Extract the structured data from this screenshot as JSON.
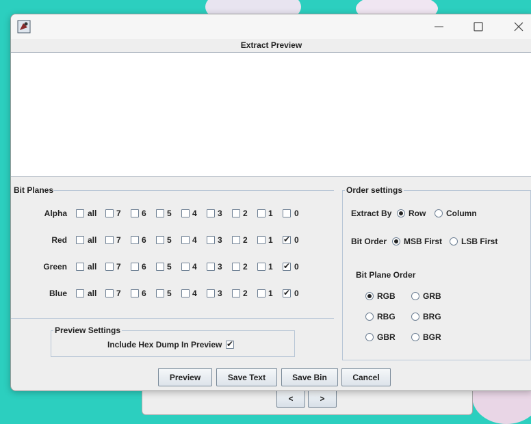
{
  "dialog": {
    "title": "Extract Preview",
    "bit_planes": {
      "title": "Bit Planes",
      "rows": [
        {
          "label": "Alpha",
          "checks": [
            false,
            false,
            false,
            false,
            false,
            false,
            false,
            false,
            false
          ]
        },
        {
          "label": "Red",
          "checks": [
            false,
            false,
            false,
            false,
            false,
            false,
            false,
            false,
            true
          ]
        },
        {
          "label": "Green",
          "checks": [
            false,
            false,
            false,
            false,
            false,
            false,
            false,
            false,
            true
          ]
        },
        {
          "label": "Blue",
          "checks": [
            false,
            false,
            false,
            false,
            false,
            false,
            false,
            false,
            true
          ]
        }
      ],
      "column_labels": [
        "all",
        "7",
        "6",
        "5",
        "4",
        "3",
        "2",
        "1",
        "0"
      ]
    },
    "preview_settings": {
      "title": "Preview Settings",
      "hex_dump_label": "Include Hex Dump In Preview",
      "hex_dump_checked": true
    },
    "order_settings": {
      "title": "Order settings",
      "extract_by_label": "Extract By",
      "extract_by_options": [
        "Row",
        "Column"
      ],
      "extract_by_selected": "Row",
      "bit_order_label": "Bit Order",
      "bit_order_options": [
        "MSB First",
        "LSB First"
      ],
      "bit_order_selected": "MSB First",
      "bit_plane_order_label": "Bit Plane Order",
      "bit_plane_order_options": [
        "RGB",
        "GRB",
        "RBG",
        "BRG",
        "GBR",
        "BGR"
      ],
      "bit_plane_order_selected": "RGB"
    },
    "buttons": {
      "preview": "Preview",
      "save_text": "Save Text",
      "save_bin": "Save Bin",
      "cancel": "Cancel"
    }
  },
  "background_window": {
    "prev_label": "<",
    "next_label": ">"
  }
}
